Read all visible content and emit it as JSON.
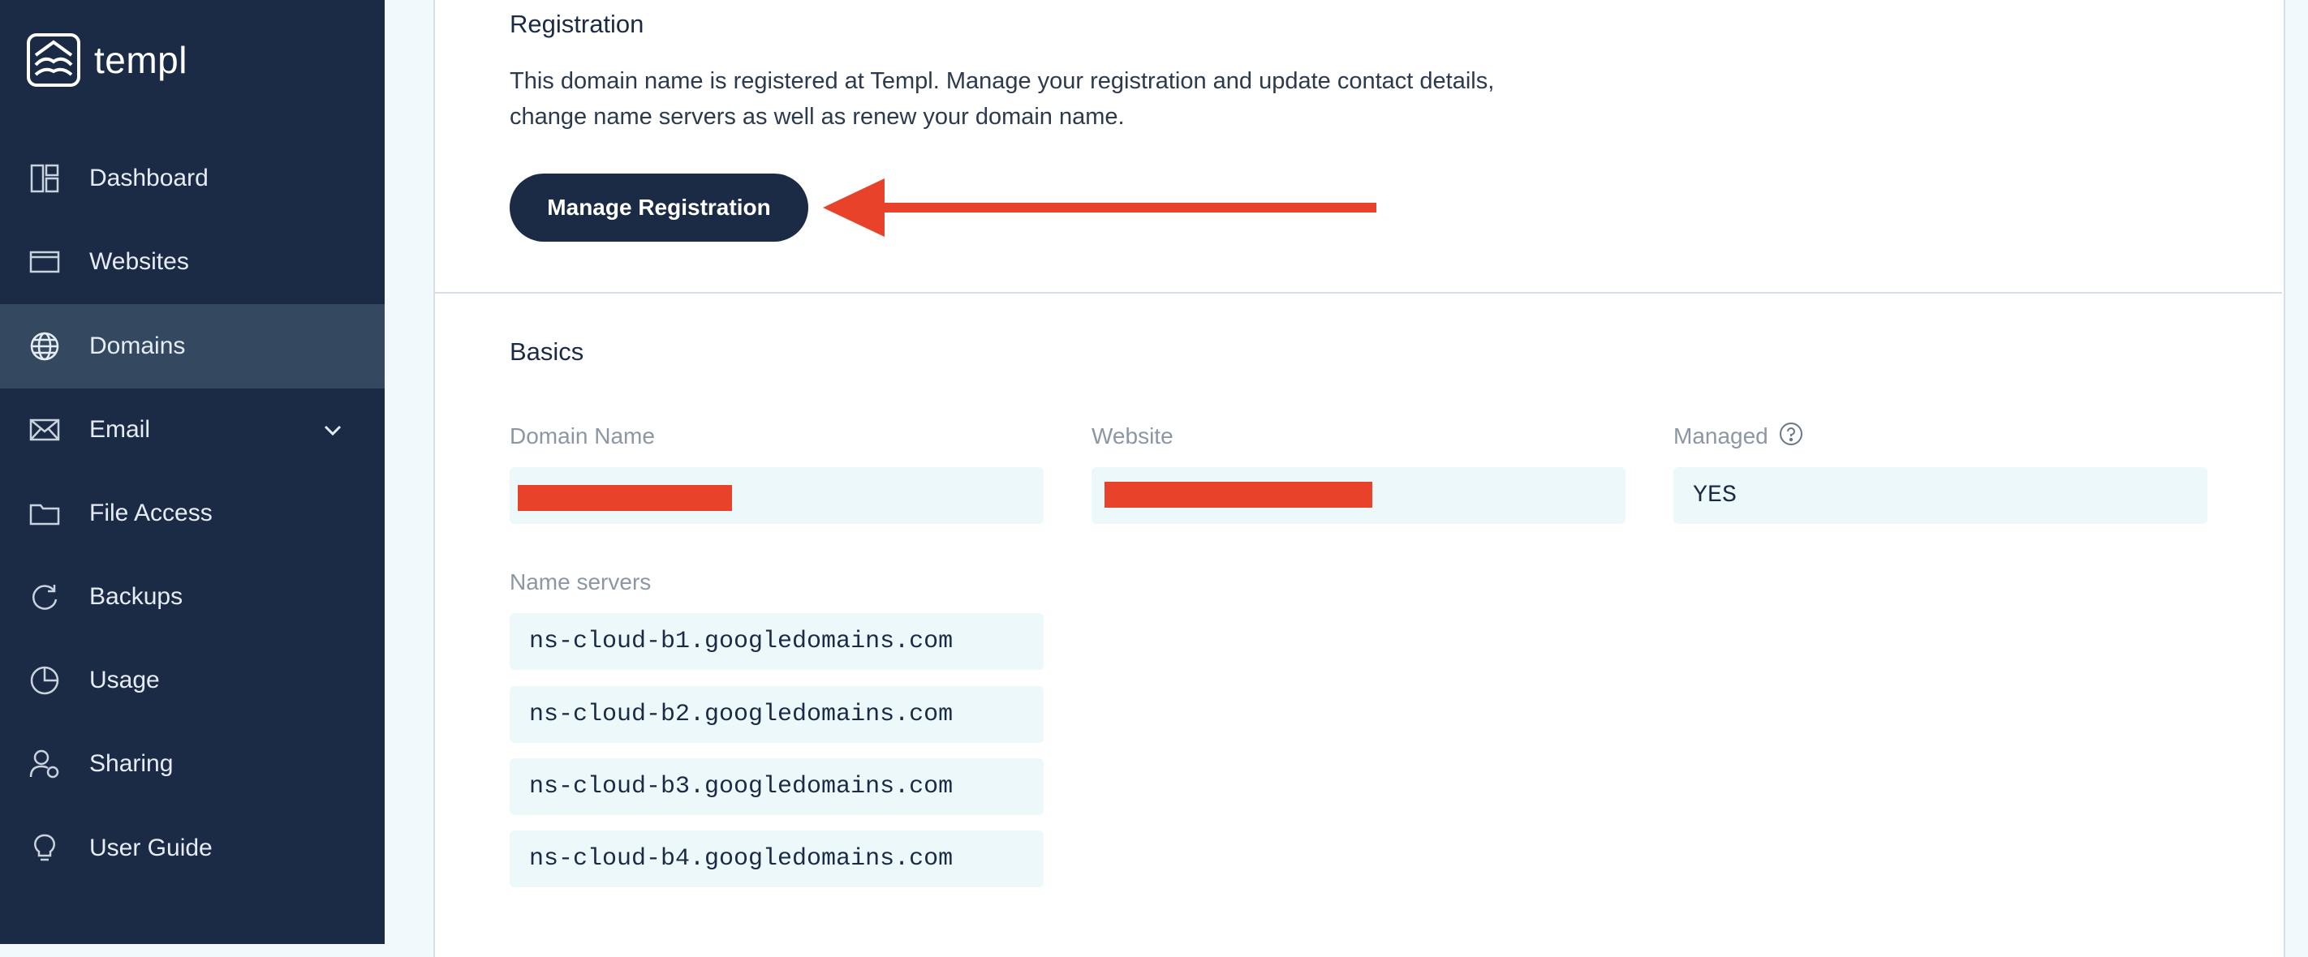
{
  "brand": {
    "name": "templ"
  },
  "sidebar": {
    "items": [
      {
        "label": "Dashboard",
        "icon": "dashboard-icon"
      },
      {
        "label": "Websites",
        "icon": "browser-window-icon"
      },
      {
        "label": "Domains",
        "icon": "globe-icon",
        "active": true
      },
      {
        "label": "Email",
        "icon": "envelope-icon",
        "expandable": true
      },
      {
        "label": "File Access",
        "icon": "folder-icon"
      },
      {
        "label": "Backups",
        "icon": "refresh-icon"
      },
      {
        "label": "Usage",
        "icon": "pie-chart-icon"
      },
      {
        "label": "Sharing",
        "icon": "user-settings-icon"
      },
      {
        "label": "User Guide",
        "icon": "lightbulb-icon"
      }
    ]
  },
  "registration": {
    "title": "Registration",
    "description_line1": "This domain name is registered at Templ. Manage your registration and update contact details,",
    "description_line2": "change name servers as well as renew your domain name.",
    "button_label": "Manage Registration"
  },
  "basics": {
    "title": "Basics",
    "domain_name_label": "Domain Name",
    "website_label": "Website",
    "managed_label": "Managed",
    "managed_value": "YES",
    "name_servers_label": "Name servers",
    "name_servers": [
      "ns-cloud-b1.googledomains.com",
      "ns-cloud-b2.googledomains.com",
      "ns-cloud-b3.googledomains.com",
      "ns-cloud-b4.googledomains.com"
    ]
  },
  "colors": {
    "sidebar_bg": "#1b2b45",
    "sidebar_active": "#34495f",
    "accent_red": "#e8432a",
    "field_bg": "#edf8fb"
  }
}
